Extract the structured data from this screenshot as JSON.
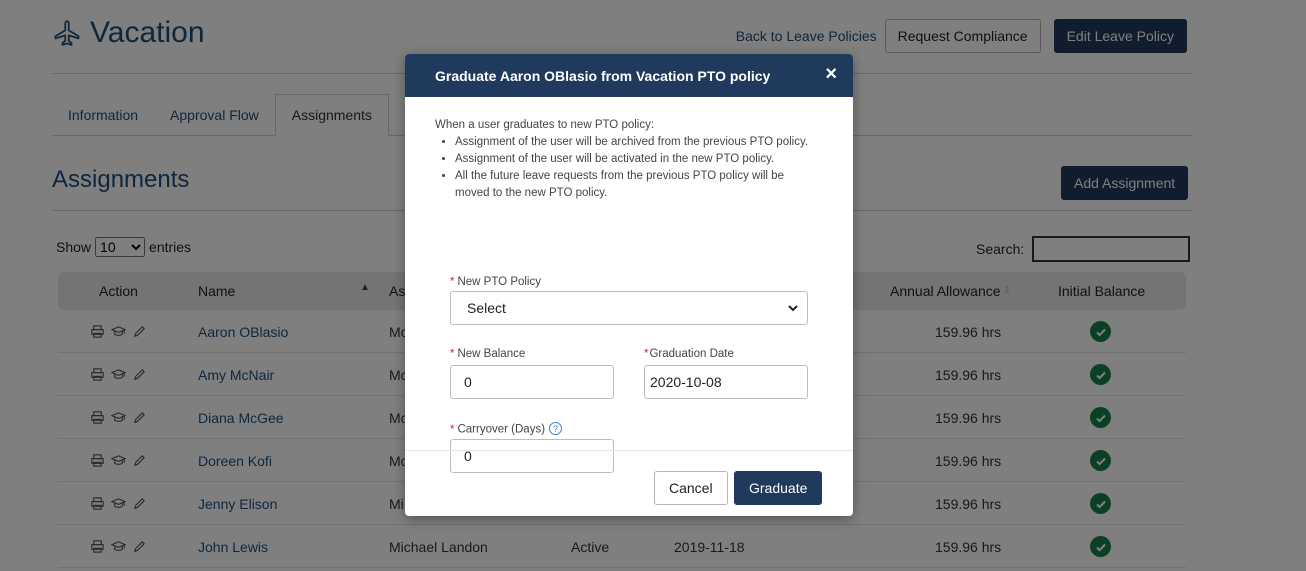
{
  "header": {
    "title": "Vacation",
    "back_link": "Back to Leave Policies",
    "request_compliance": "Request Compliance",
    "edit_policy": "Edit Leave Policy"
  },
  "tabs": [
    {
      "label": "Information"
    },
    {
      "label": "Approval Flow"
    },
    {
      "label": "Assignments"
    }
  ],
  "section": {
    "title": "Assignments",
    "add_button": "Add Assignment"
  },
  "table_controls": {
    "show_label": "Show",
    "entries_value": "10",
    "entries_label": "entries",
    "search_label": "Search:",
    "search_value": ""
  },
  "table": {
    "columns": [
      "Action",
      "Name",
      "As",
      "Annual Allowance",
      "Initial Balance"
    ],
    "rows": [
      {
        "name": "Aaron OBlasio",
        "manager": "Mc",
        "status": "",
        "date": "",
        "allowance": "159.96 hrs"
      },
      {
        "name": "Amy McNair",
        "manager": "Mc",
        "status": "",
        "date": "",
        "allowance": "159.96 hrs"
      },
      {
        "name": "Diana McGee",
        "manager": "Mc",
        "status": "",
        "date": "",
        "allowance": "159.96 hrs"
      },
      {
        "name": "Doreen Kofi",
        "manager": "Mc",
        "status": "",
        "date": "",
        "allowance": "159.96 hrs"
      },
      {
        "name": "Jenny Elison",
        "manager": "Mi",
        "status": "",
        "date": "",
        "allowance": "159.96 hrs"
      },
      {
        "name": "John Lewis",
        "manager": "Michael Landon",
        "status": "Active",
        "date": "2019-11-18",
        "allowance": "159.96 hrs"
      }
    ]
  },
  "modal": {
    "title": "Graduate Aaron OBlasio from Vacation PTO policy",
    "close_glyph": "×",
    "intro": "When a user graduates to new PTO policy:",
    "bullets": [
      "Assignment of the user will be archived from the previous PTO policy.",
      "Assignment of the user will be activated in the new PTO policy.",
      "All the future leave requests from the previous PTO policy will be moved to the new PTO policy."
    ],
    "required_mark": "*",
    "new_policy_label": "New PTO Policy",
    "new_policy_value": "Select",
    "new_balance_label": "New Balance",
    "new_balance_value": "0",
    "graduation_date_label": "Graduation Date",
    "graduation_date_value": "2020-10-08",
    "carryover_label": "Carryover (Days)",
    "carryover_value": "0",
    "help_glyph": "?",
    "cancel": "Cancel",
    "graduate": "Graduate"
  },
  "colors": {
    "primary": "#1f3a5c",
    "link": "#1f4e79",
    "success": "#19804a",
    "required": "#d62727"
  }
}
